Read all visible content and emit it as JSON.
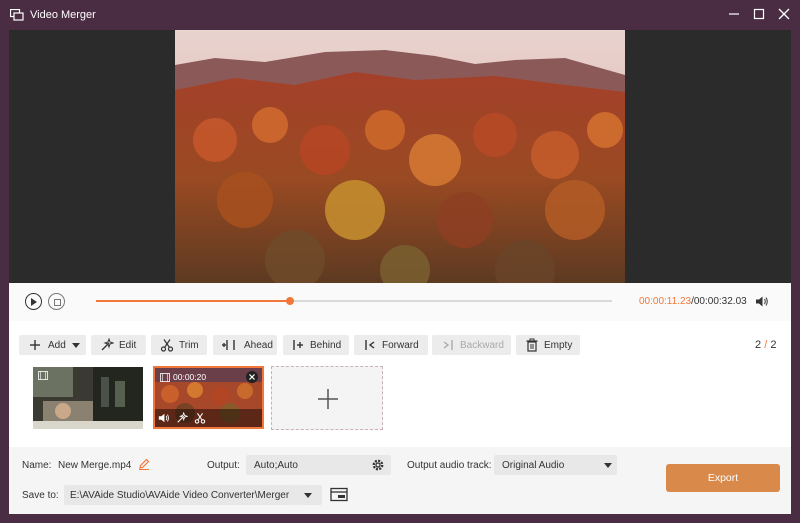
{
  "window": {
    "title": "Video Merger"
  },
  "player": {
    "current_time": "00:00:11.23",
    "separator": "/",
    "total_time": "00:00:32.03",
    "progress": 0.375
  },
  "toolbar": {
    "add": "Add",
    "edit": "Edit",
    "trim": "Trim",
    "ahead": "Ahead",
    "behind": "Behind",
    "forward": "Forward",
    "backward": "Backward",
    "empty": "Empty",
    "count_current": "2",
    "count_sep": "/",
    "count_total": "2"
  },
  "clips": [
    {
      "duration": ""
    },
    {
      "duration": "00:00:20"
    }
  ],
  "output": {
    "name_label": "Name:",
    "name_value": "New Merge.mp4",
    "output_label": "Output:",
    "output_value": "Auto;Auto",
    "audio_label": "Output audio track:",
    "audio_value": "Original Audio",
    "save_label": "Save to:",
    "save_path": "E:\\AVAide Studio\\AVAide Video Converter\\Merger",
    "export": "Export"
  },
  "colors": {
    "accent": "#f1773a",
    "titlebar": "#4a2d43",
    "export": "#d9894a"
  }
}
